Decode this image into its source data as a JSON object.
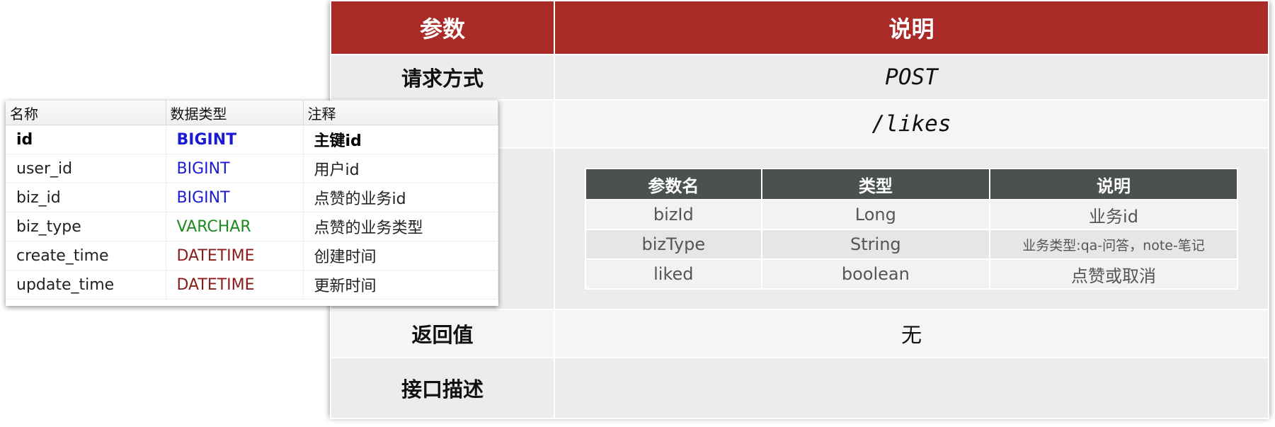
{
  "api_doc": {
    "header": {
      "param": "参数",
      "desc": "说明"
    },
    "rows": {
      "method": {
        "key": "请求方式",
        "value": "POST"
      },
      "path": {
        "key": "",
        "value": "/likes"
      },
      "return": {
        "key": "返回值",
        "value": "无"
      },
      "description": {
        "key": "接口描述",
        "value": ""
      }
    },
    "params_table": {
      "headers": [
        "参数名",
        "类型",
        "说明"
      ],
      "rows": [
        [
          "bizId",
          "Long",
          "业务id"
        ],
        [
          "bizType",
          "String",
          "业务类型:qa-问答，note-笔记"
        ],
        [
          "liked",
          "boolean",
          "点赞或取消"
        ]
      ]
    },
    "colors": {
      "header_bg": "#aa2a27",
      "subheader_bg": "#4b5050"
    }
  },
  "db_schema": {
    "headers": [
      "名称",
      "数据类型",
      "注释"
    ],
    "rows": [
      [
        "id",
        "BIGINT",
        "主键id"
      ],
      [
        "user_id",
        "BIGINT",
        "用户id"
      ],
      [
        "biz_id",
        "BIGINT",
        "点赞的业务id"
      ],
      [
        "biz_type",
        "VARCHAR",
        "点赞的业务类型"
      ],
      [
        "create_time",
        "DATETIME",
        "创建时间"
      ],
      [
        "update_time",
        "DATETIME",
        "更新时间"
      ]
    ],
    "type_colors": {
      "BIGINT": "#1b1bd6",
      "VARCHAR": "#1d8a1d",
      "DATETIME": "#8b1a1a"
    }
  }
}
